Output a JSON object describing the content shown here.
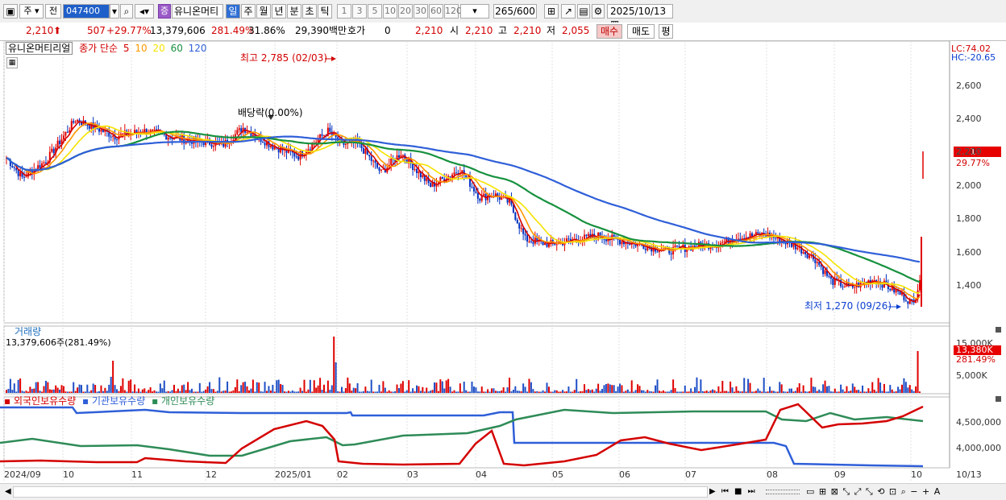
{
  "toolbar": {
    "market": "주",
    "prev": "전",
    "code": "047400",
    "badge": "증",
    "name": "유니온머티",
    "periods": [
      "일",
      "주",
      "월",
      "년",
      "분",
      "초",
      "틱"
    ],
    "intervals": [
      "1",
      "3",
      "5",
      "10",
      "20",
      "30",
      "60",
      "120"
    ],
    "count": "265",
    "count_total": "/600",
    "date": "2025/10/13"
  },
  "quote": {
    "price": "2,210",
    "change": "507",
    "change_pct": "+29.77%",
    "volume": "13,379,606",
    "volume_ratio": "281.49%",
    "turnover": "31.86%",
    "amount": "29,390백만",
    "hoga_label": "호가",
    "hoga": "0",
    "hoga_price": "2,210",
    "open_label": "시",
    "open": "2,210",
    "high_label": "고",
    "high": "2,210",
    "low_label": "저",
    "low": "2,055",
    "buy": "매수",
    "sell": "매도",
    "eval": "평"
  },
  "price_panel": {
    "title": "유니온머티리얼",
    "ma_label": "종가 단순",
    "ma_periods": [
      "5",
      "10",
      "20",
      "60",
      "120"
    ],
    "ma_colors": [
      "#d40000",
      "#ff9800",
      "#f5e300",
      "#16913e",
      "#2f5fd8"
    ],
    "max_label": "최고 2,785 (02/03)",
    "div_label": "배당락(0.00%)",
    "min_label": "최저 1,270 (09/26)",
    "lc": "LC:74.02",
    "hc": "HC:-20.65",
    "last_price": "2,210",
    "last_pct": "29.77%",
    "yticks": [
      "2,600",
      "2,400",
      "2,200",
      "2,000",
      "1,800",
      "1,600",
      "1,400"
    ]
  },
  "volume_panel": {
    "title": "거래량",
    "value": "13,379,606주(281.49%)",
    "last": "13,380K",
    "last_pct": "281.49%",
    "yticks": [
      "15,000K",
      "5,000K"
    ]
  },
  "holding_panel": {
    "labels": [
      "외국인보유수량",
      "기관보유수량",
      "개인보유수량"
    ],
    "colors": [
      "#d40000",
      "#2f5fd8",
      "#2e8b57"
    ],
    "yticks": [
      "4,500,000",
      "4,000,000"
    ]
  },
  "xaxis": [
    "2024/09",
    "10",
    "11",
    "12",
    "2025/01",
    "02",
    "03",
    "04",
    "05",
    "06",
    "07",
    "08",
    "09",
    "10",
    "10/13"
  ]
}
